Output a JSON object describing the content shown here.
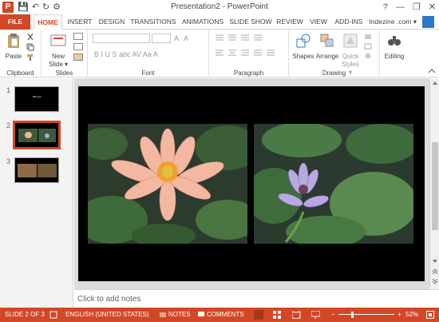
{
  "window": {
    "title": "Presentation2 - PowerPoint",
    "app_icon": "P"
  },
  "qat": {
    "save": "💾",
    "undo": "↶",
    "redo": "↻",
    "start": "⚙"
  },
  "window_controls": {
    "help": "?",
    "minimize": "—",
    "restore": "❐",
    "close": "✕"
  },
  "tabs": [
    "FILE",
    "HOME",
    "INSERT",
    "DESIGN",
    "TRANSITIONS",
    "ANIMATIONS",
    "SLIDE SHOW",
    "REVIEW",
    "VIEW",
    "ADD-INS"
  ],
  "active_tab": "HOME",
  "user": "Indezine .com ▾",
  "ribbon": {
    "clipboard": {
      "label": "Clipboard",
      "paste": "Paste"
    },
    "slides": {
      "label": "Slides",
      "new_slide": "New Slide ▾"
    },
    "font": {
      "label": "Font",
      "row2": "B  I  U  S  abc  AV  Aa  A"
    },
    "paragraph": {
      "label": "Paragraph"
    },
    "drawing": {
      "label": "Drawing",
      "shapes": "Shapes",
      "arrange": "Arrange",
      "quick_styles": "Quick Styles ▾"
    },
    "editing": {
      "label": "",
      "editing": "Editing"
    }
  },
  "thumbnails": [
    {
      "number": "1",
      "caption": "Title text"
    },
    {
      "number": "2"
    },
    {
      "number": "3"
    }
  ],
  "notes_placeholder": "Click to add notes",
  "status": {
    "slide": "SLIDE 2 OF 3",
    "language": "ENGLISH (UNITED STATES)",
    "notes": "NOTES",
    "comments": "COMMENTS",
    "zoom": "52%",
    "zoom_fraction": 0.52
  },
  "colors": {
    "accent": "#d24726",
    "slide_bg": "#000000",
    "status_bar": "#d24726"
  }
}
